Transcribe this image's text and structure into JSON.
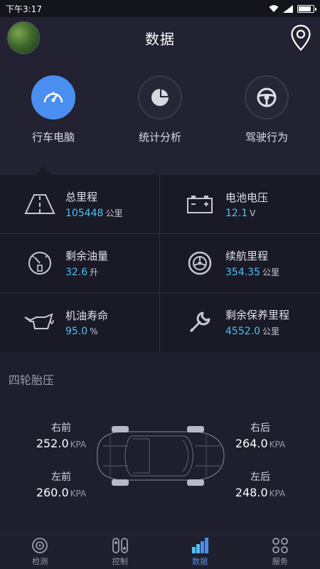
{
  "status_bar": {
    "time": "下午3:17"
  },
  "header": {
    "title": "数据"
  },
  "features": [
    {
      "label": "行车电脑",
      "icon": "speedometer-icon",
      "active": true
    },
    {
      "label": "统计分析",
      "icon": "pie-chart-icon",
      "active": false
    },
    {
      "label": "驾驶行为",
      "icon": "steering-wheel-icon",
      "active": false
    }
  ],
  "stats": [
    {
      "label": "总里程",
      "value": "105448",
      "unit": "公里",
      "icon": "road-icon"
    },
    {
      "label": "电池电压",
      "value": "12.1",
      "unit": "V",
      "icon": "battery-icon"
    },
    {
      "label": "剩余油量",
      "value": "32.6",
      "unit": "升",
      "icon": "fuel-gauge-icon"
    },
    {
      "label": "续航里程",
      "value": "354.35",
      "unit": "公里",
      "icon": "tire-icon"
    },
    {
      "label": "机油寿命",
      "value": "95.0",
      "unit": "%",
      "icon": "oil-can-icon"
    },
    {
      "label": "剩余保养里程",
      "value": "4552.0",
      "unit": "公里",
      "icon": "wrench-icon"
    }
  ],
  "tire_section": {
    "title": "四轮胎压",
    "unit": "KPA",
    "front_right": {
      "label": "右前",
      "value": "252.0"
    },
    "rear_right": {
      "label": "右后",
      "value": "264.0"
    },
    "front_left": {
      "label": "左前",
      "value": "260.0"
    },
    "rear_left": {
      "label": "左后",
      "value": "248.0"
    }
  },
  "nav": [
    {
      "label": "检测",
      "icon": "detect-icon",
      "active": false
    },
    {
      "label": "控制",
      "icon": "control-icon",
      "active": false
    },
    {
      "label": "数据",
      "icon": "data-bars-icon",
      "active": true
    },
    {
      "label": "服务",
      "icon": "service-icon",
      "active": false
    }
  ],
  "colors": {
    "accent": "#4a8ef0",
    "value": "#4fc1f4",
    "background": "#1c1c2a"
  }
}
